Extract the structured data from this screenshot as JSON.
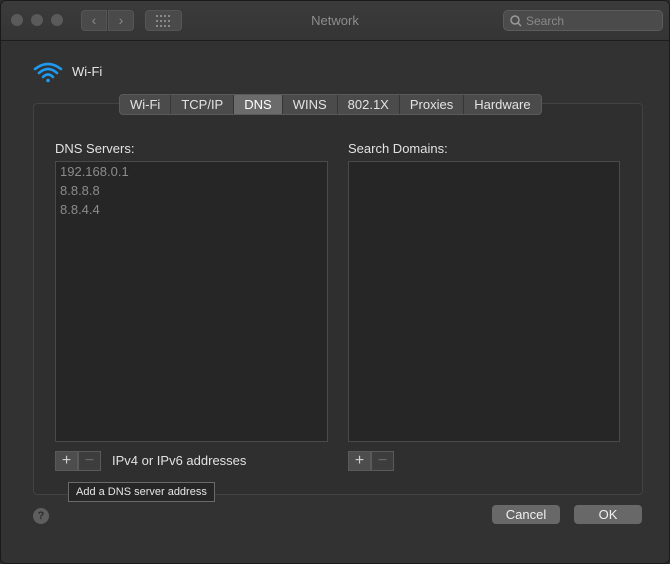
{
  "window": {
    "title": "Network"
  },
  "toolbar": {
    "back_symbol": "‹",
    "forward_symbol": "›",
    "search_placeholder": "Search"
  },
  "header": {
    "interface_name": "Wi-Fi"
  },
  "tabs": [
    {
      "label": "Wi-Fi"
    },
    {
      "label": "TCP/IP"
    },
    {
      "label": "DNS"
    },
    {
      "label": "WINS"
    },
    {
      "label": "802.1X"
    },
    {
      "label": "Proxies"
    },
    {
      "label": "Hardware"
    }
  ],
  "active_tab": "DNS",
  "dns": {
    "label": "DNS Servers:",
    "servers": [
      "192.168.0.1",
      "8.8.8.8",
      "8.8.4.4"
    ],
    "hint": "IPv4 or IPv6 addresses"
  },
  "search_domains": {
    "label": "Search Domains:"
  },
  "buttons": {
    "add": "+",
    "remove": "−"
  },
  "tooltip": "Add a DNS server address",
  "help": "?",
  "actions": {
    "cancel": "Cancel",
    "ok": "OK"
  },
  "colors": {
    "window_bg": "#323232",
    "active_tab": "#6b6b6b",
    "wifi_icon": "#1e9bf0"
  }
}
